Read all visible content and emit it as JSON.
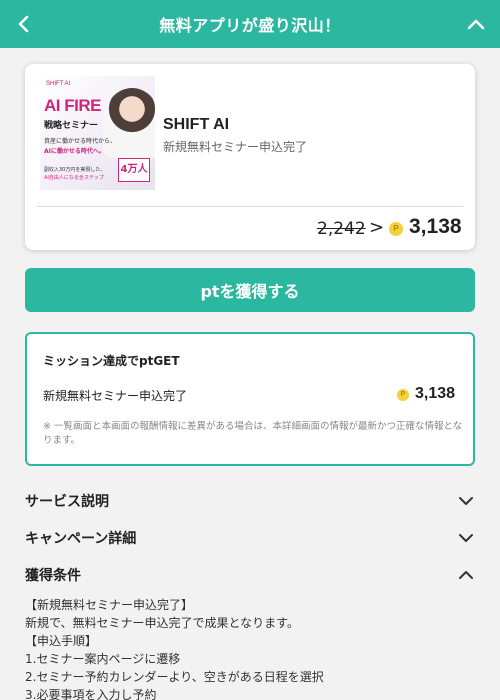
{
  "header": {
    "title": "無料アプリが盛り沢山！",
    "back_icon": "chevron-left-icon",
    "collapse_icon": "chevron-up-icon"
  },
  "offer": {
    "thumbnail": {
      "brand": "SHIFT AI",
      "headline": "AI FIRE",
      "subhead": "戦略セミナー",
      "line1": "資産に働かせる時代から、",
      "line2": "AIに働かせる時代へ。",
      "line3": "副収入30万円を実現した、",
      "line4": "AI自由人になる全ステップ",
      "badge": "4万人"
    },
    "name": "SHIFT AI",
    "description": "新規無料セミナー申込完了",
    "old_points": "2,242",
    "arrow": ">",
    "new_points": "3,138",
    "coin_symbol": "P"
  },
  "cta": {
    "label": "ptを獲得する"
  },
  "mission": {
    "title": "ミッション達成でptGET",
    "label": "新規無料セミナー申込完了",
    "points": "3,138",
    "note": "※ 一覧画面と本画面の報酬情報に差異がある場合は、本詳細画面の情報が最新かつ正確な情報となります。"
  },
  "sections": [
    {
      "label": "サービス説明",
      "state": "collapsed"
    },
    {
      "label": "キャンペーン詳細",
      "state": "collapsed"
    },
    {
      "label": "獲得条件",
      "state": "expanded"
    }
  ],
  "conditions": {
    "line1": "【新規無料セミナー申込完了】",
    "line2": "新規で、無料セミナー申込完了で成果となります。",
    "line3": "【申込手順】",
    "line4": "1.セミナー案内ページに遷移",
    "line5": "2.セミナー予約カレンダーより、空きがある日程を選択",
    "line6": "3.必要事項を入力し予約"
  },
  "colors": {
    "accent": "#2cb8a0",
    "coin": "#f3d23a",
    "brand_pink": "#d0257a"
  }
}
